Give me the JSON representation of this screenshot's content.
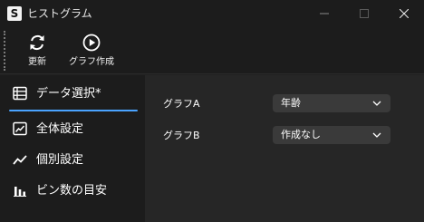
{
  "window": {
    "title": "ヒストグラム",
    "app_icon_letter": "S"
  },
  "toolbar": {
    "refresh_label": "更新",
    "create_label": "グラフ作成"
  },
  "sidebar": {
    "items": [
      {
        "label": "データ選択*",
        "icon": "table-icon",
        "active": true
      },
      {
        "label": "全体設定",
        "icon": "trend-chart-icon",
        "active": false
      },
      {
        "label": "個別設定",
        "icon": "line-chart-icon",
        "active": false
      },
      {
        "label": "ビン数の目安",
        "icon": "bar-chart-icon",
        "active": false
      }
    ]
  },
  "main": {
    "graph_a": {
      "label": "グラフA",
      "value": "年齢"
    },
    "graph_b": {
      "label": "グラフB",
      "value": "作成なし"
    }
  },
  "colors": {
    "accent": "#4aa3ff",
    "background": "#202020",
    "sidebar": "#1c1c1c",
    "panel": "#262626",
    "select": "#3a3a3a"
  }
}
